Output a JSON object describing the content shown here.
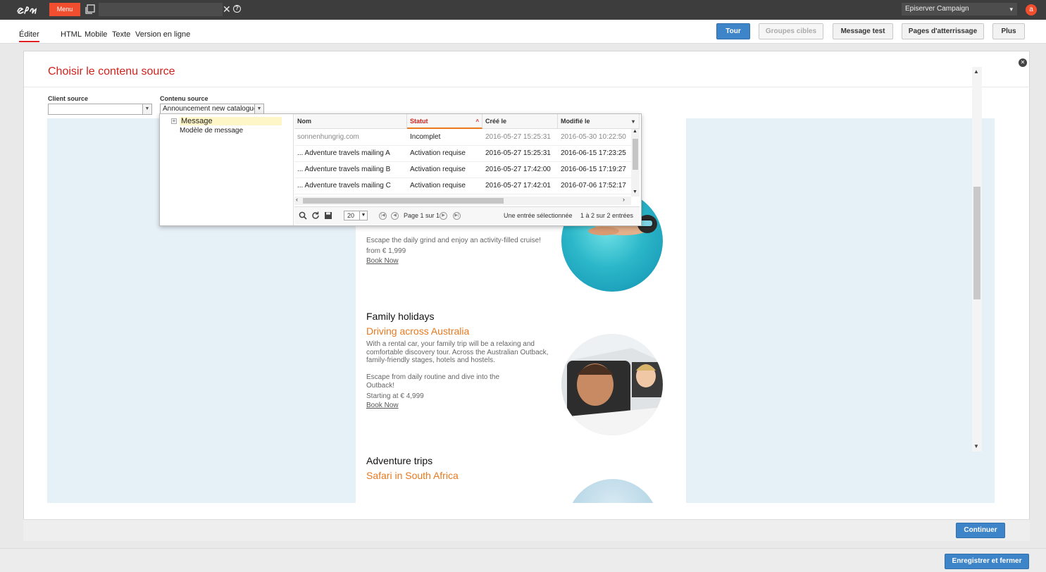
{
  "topbar": {
    "menu_label": "Menu",
    "close_glyph": "✕",
    "help_glyph": "?",
    "app_selector_value": "Episerver Campaign",
    "avatar_letter": "a"
  },
  "editbar": {
    "tabs": [
      {
        "label": "Éditer"
      },
      {
        "label": "HTML"
      },
      {
        "label": "Mobile"
      },
      {
        "label": "Texte"
      },
      {
        "label": "Version en ligne"
      }
    ],
    "buttons": {
      "tour": "Tour",
      "target_groups": "Groupes cibles",
      "test_message": "Message test",
      "landing_pages": "Pages d'atterrissage",
      "more": "Plus"
    }
  },
  "dialog": {
    "title": "Choisir le contenu source",
    "client_source_label": "Client source",
    "client_source_value": "",
    "content_source_label": "Contenu source",
    "content_source_value": "Announcement new catalogue",
    "continue_label": "Continuer"
  },
  "picker": {
    "tree": [
      {
        "label": "Message",
        "selected": true
      },
      {
        "label": "Modèle de message",
        "selected": false
      }
    ],
    "columns": [
      "Nom",
      "Statut",
      "Créé le",
      "Modifié le"
    ],
    "sorted_column": "Statut",
    "rows": [
      {
        "name": "sonnenhungrig.com",
        "status": "Incomplet",
        "created": "2016-05-27 15:25:31",
        "modified": "2016-05-30 10:22:50"
      },
      {
        "name": "... Adventure travels mailing A",
        "status": "Activation requise",
        "created": "2016-05-27 15:25:31",
        "modified": "2016-06-15 17:23:25"
      },
      {
        "name": "... Adventure travels mailing B",
        "status": "Activation requise",
        "created": "2016-05-27 17:42:00",
        "modified": "2016-06-15 17:19:27"
      },
      {
        "name": "... Adventure travels mailing C",
        "status": "Activation requise",
        "created": "2016-05-27 17:42:01",
        "modified": "2016-07-06 17:52:17"
      }
    ],
    "page_size": "20",
    "page_info": "Page 1 sur 1",
    "selection_info": "Une entrée sélectionnée",
    "count_info": "1 à 2 sur 2 entrées"
  },
  "email": {
    "cruise_teaser": "Escape the daily grind and enjoy an activity-filled cruise!",
    "cruise_price": "from € 1,999",
    "cruise_link": "Book Now",
    "family_heading": "Family holidays",
    "family_sub": "Driving across Australia",
    "family_body_1": "With a rental car, your family trip will be a relaxing and",
    "family_body_2": "comfortable discovery tour. Across the Australian Outback,",
    "family_body_3": "family-friendly stages, hotels and hostels.",
    "family_body_4": "Escape from daily routine and dive into the",
    "family_body_5": "Outback!",
    "family_price": "Starting at € 4,999",
    "family_link": "Book Now",
    "adventure_heading": "Adventure trips",
    "adventure_sub": "Safari in South Africa"
  },
  "footer": {
    "save_close_label": "Enregistrer et fermer"
  },
  "colors": {
    "brand_red": "#f04e2f",
    "primary_blue": "#3e84c8",
    "title_red": "#d0211c",
    "accent_orange": "#e8791f"
  }
}
